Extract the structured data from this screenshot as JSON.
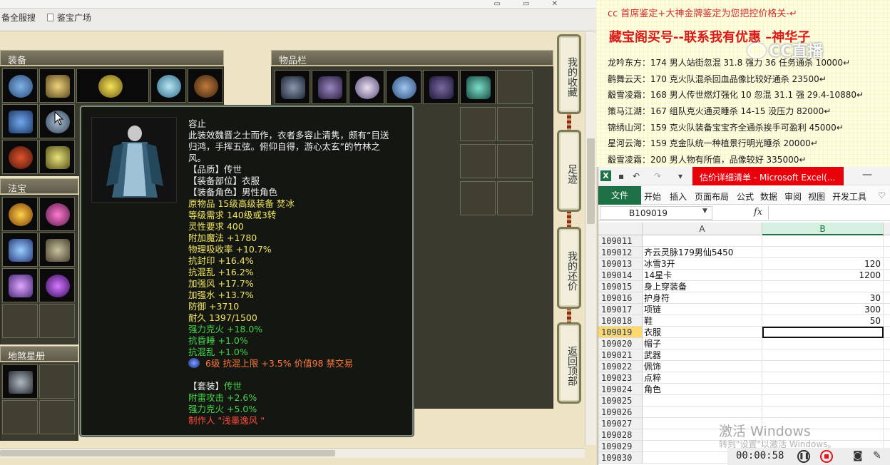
{
  "browser": {
    "bookmark1": "备全服搜",
    "bookmark2": "鉴宝广场"
  },
  "game": {
    "equip_header": "装备",
    "fabao_header": "法宝",
    "xingce_header": "地煞星册",
    "bag_header": "物品栏",
    "side_buttons": [
      {
        "label": "我的收藏"
      },
      {
        "label": "足迹"
      },
      {
        "label": "我的还价"
      },
      {
        "label": "返回顶部"
      }
    ],
    "tooltip": {
      "name": "容止",
      "desc_lines": [
        "此装效魏晋之士而作，衣者多容止清隽，颇有“目送",
        "归鸿，手挥五弦。俯仰自得，游心太玄”的竹林之",
        "风。"
      ],
      "quality": "【品质】传世",
      "slot": "【装备部位】衣服",
      "role": "【装备角色】男性角色",
      "stats_yellow": [
        "原物品 15级高级装备 焚冰",
        "等级需求 140级或3转",
        "灵性要求 400",
        "附加魔法 +1780",
        "物理吸收率 +10.7%",
        "抗封印 +16.4%",
        "抗混乱 +16.2%",
        "加强风 +17.7%",
        "加强水 +13.7%",
        "防御 +3710",
        "耐久 1397/1500"
      ],
      "stats_green": [
        "强力克火 +18.0%",
        "抗昏睡 +1.0%",
        "抗混乱 +1.0%"
      ],
      "gem_line": "6级 抗混上限 +3.5% 价值98 禁交易",
      "set_title": "【套装】",
      "set_name": "传世",
      "set_lines": [
        "附雷攻击 +2.6%",
        "强力克火 +5.0%"
      ],
      "maker": "制作人 \"浅墨逸风 \""
    }
  },
  "notes": {
    "header1": "cc 首席鉴定+大神金牌鉴定为您把控价格关-↵",
    "header2": "藏宝阁买号--联系我有优惠 –神华子",
    "lines": [
      "龙吟东方：174 男人站街忽混 31.8 强力 36 任务通杀 10000↵",
      "鹳舞云天：170 克火队混杀回血品像比较好通杀 23500↵",
      "觳雪凌霜：168 男人传世燃灯强化 10 忽混 31.1 强 29.4-10880↵",
      "策马江湖：167 组队克火通灵睡杀 14-15 没压力 82000↵",
      "锦绣山河：159 克火队装备宝宝齐全通杀挨手可盈利 45000↵",
      "星河云海：159 克金队统一种植景行明光睡杀 20000↵",
      "觳雪凌霜：200 男人物有所值，品像较好 335000↵"
    ],
    "watermark": "CC直播"
  },
  "excel": {
    "title": "估价详细清单 - Microsoft Excel(...",
    "file_tab": "文件",
    "tabs": [
      "开始",
      "插入",
      "页面布局",
      "公式",
      "数据",
      "审阅",
      "视图",
      "开发工具"
    ],
    "name_box": "B109019",
    "fx": "fx",
    "columns": [
      "A",
      "B"
    ],
    "rows": [
      {
        "num": "109011",
        "a": "",
        "b": ""
      },
      {
        "num": "109012",
        "a": "齐云灵脉179男仙5450",
        "b": ""
      },
      {
        "num": "109013",
        "a": "冰雪3开",
        "b": "120"
      },
      {
        "num": "109014",
        "a": "14星卡",
        "b": "1200"
      },
      {
        "num": "109015",
        "a": "身上穿装备",
        "b": ""
      },
      {
        "num": "109016",
        "a": "护身符",
        "b": "30"
      },
      {
        "num": "109017",
        "a": "项链",
        "b": "300"
      },
      {
        "num": "109018",
        "a": "鞋",
        "b": "50"
      },
      {
        "num": "109019",
        "a": "衣服",
        "b": ""
      },
      {
        "num": "109020",
        "a": "帽子",
        "b": ""
      },
      {
        "num": "109021",
        "a": "武器",
        "b": ""
      },
      {
        "num": "109022",
        "a": "佩饰",
        "b": ""
      },
      {
        "num": "109023",
        "a": "点粹",
        "b": ""
      },
      {
        "num": "109024",
        "a": "角色",
        "b": ""
      },
      {
        "num": "109025",
        "a": "",
        "b": ""
      },
      {
        "num": "109026",
        "a": "",
        "b": ""
      },
      {
        "num": "109027",
        "a": "",
        "b": ""
      },
      {
        "num": "109028",
        "a": "",
        "b": ""
      },
      {
        "num": "109029",
        "a": "",
        "b": ""
      },
      {
        "num": "109030",
        "a": "",
        "b": ""
      }
    ],
    "selected_row": "109019"
  },
  "os": {
    "activate_title": "激活 Windows",
    "activate_sub": "转到\"设置\"以激活 Windows。"
  },
  "recorder": {
    "time": "00:00:58"
  }
}
